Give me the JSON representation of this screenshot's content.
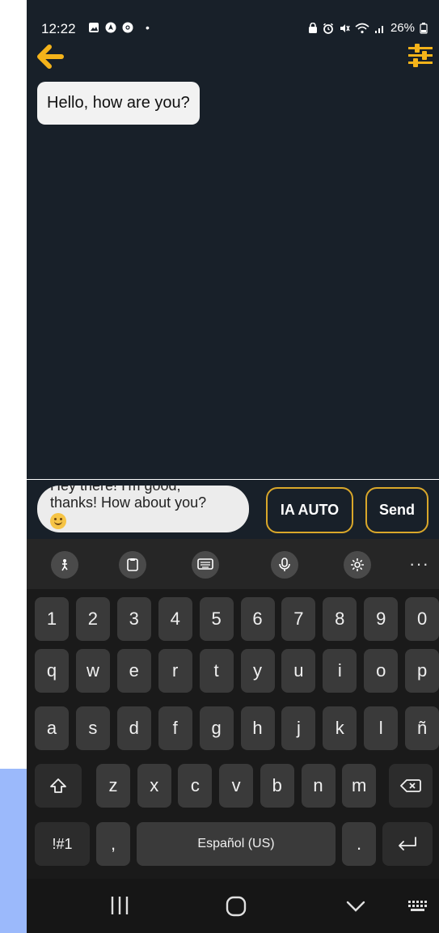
{
  "status_bar": {
    "time": "12:22",
    "dot": "•",
    "battery": "26%"
  },
  "chat": {
    "messages": [
      {
        "text": "Hello, how are you?"
      }
    ]
  },
  "input": {
    "suggestion_line1": "Hey there! I'm good,",
    "suggestion_line2": "thanks! How about you?",
    "ia_button": "IA AUTO",
    "send_button": "Send"
  },
  "keyboard": {
    "more": "···",
    "row_numbers": [
      "1",
      "2",
      "3",
      "4",
      "5",
      "6",
      "7",
      "8",
      "9",
      "0"
    ],
    "row_top": [
      "q",
      "w",
      "e",
      "r",
      "t",
      "y",
      "u",
      "i",
      "o",
      "p"
    ],
    "row_home": [
      "a",
      "s",
      "d",
      "f",
      "g",
      "h",
      "j",
      "k",
      "l",
      "ñ"
    ],
    "row_bottom": [
      "z",
      "x",
      "c",
      "v",
      "b",
      "n",
      "m"
    ],
    "symbols_key": "!#1",
    "comma_key": ",",
    "space_label": "Español (US)",
    "period_key": "."
  },
  "colors": {
    "accent": "#f4b31a",
    "background": "#182029",
    "button_border": "#d9a72a"
  }
}
